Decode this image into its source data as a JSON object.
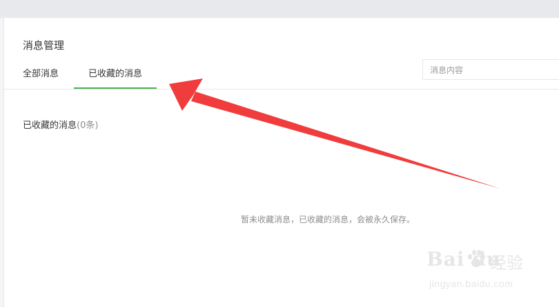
{
  "page": {
    "title": "消息管理"
  },
  "tabs": [
    {
      "label": "全部消息",
      "active": false
    },
    {
      "label": "已收藏的消息",
      "active": true
    }
  ],
  "search": {
    "placeholder": "消息内容",
    "value": ""
  },
  "section": {
    "heading": "已收藏的消息",
    "count": "(0条)"
  },
  "empty_state": "暂未收藏消息，已收藏的消息，会被永久保存。",
  "colors": {
    "active_tab_underline": "#44b549",
    "annotation_arrow": "#f03c3c"
  },
  "watermark": {
    "brand": "Bai du",
    "cn": "经验",
    "url": "jingyan.baidu.com"
  }
}
